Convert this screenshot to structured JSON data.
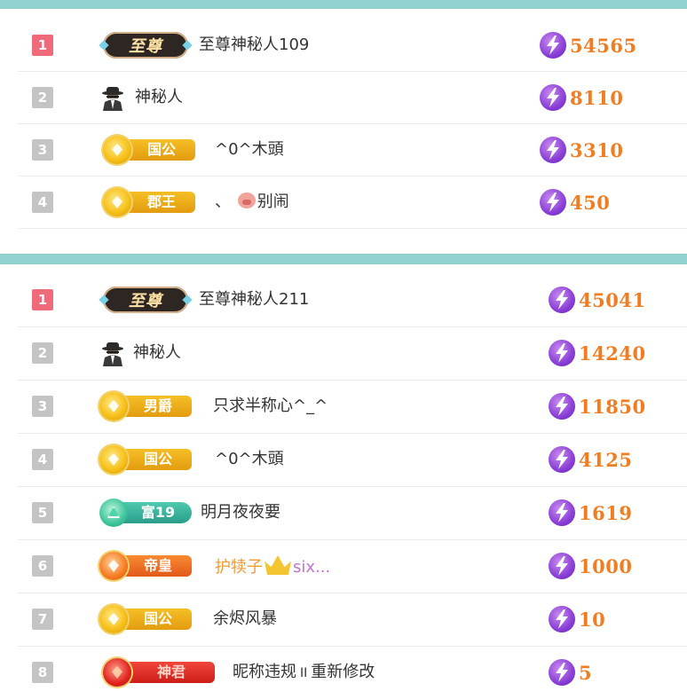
{
  "colors": {
    "accent_bar": "#91d2cf",
    "rank_first": "#f06b7a",
    "rank_other": "#c4c4c4",
    "score": "#f07d22",
    "bolt": "#8a3fd6"
  },
  "list1": {
    "rows": [
      {
        "rank": "1",
        "badge": "至尊",
        "badge_type": "zhizun",
        "name": "至尊神秘人109",
        "score": "54565"
      },
      {
        "rank": "2",
        "badge": "",
        "badge_type": "spy",
        "name": "神秘人",
        "score": "8110"
      },
      {
        "rank": "3",
        "badge": "国公",
        "badge_type": "gold",
        "name": "^0^木頭",
        "score": "3310"
      },
      {
        "rank": "4",
        "badge": "郡王",
        "badge_type": "gold",
        "name_prefix": "、",
        "name": "别闹",
        "name_icon": "pig-emoji-icon",
        "score": "450"
      }
    ]
  },
  "list2": {
    "rows": [
      {
        "rank": "1",
        "badge": "至尊",
        "badge_type": "zhizun",
        "name": "至尊神秘人211",
        "score": "45041"
      },
      {
        "rank": "2",
        "badge": "",
        "badge_type": "spy",
        "name": "神秘人",
        "score": "14240"
      },
      {
        "rank": "3",
        "badge": "男爵",
        "badge_type": "gold",
        "name": "只求半称心^_^",
        "score": "11850"
      },
      {
        "rank": "4",
        "badge": "国公",
        "badge_type": "gold",
        "name": "^0^木頭",
        "score": "4125"
      },
      {
        "rank": "5",
        "badge": "富19",
        "badge_type": "fu",
        "name": "明月夜夜要",
        "score": "1619"
      },
      {
        "rank": "6",
        "badge": "帝皇",
        "badge_type": "orange",
        "name": "护犊子",
        "name_suffix": "six...",
        "name_icon": "crown-icon",
        "score": "1000"
      },
      {
        "rank": "7",
        "badge": "国公",
        "badge_type": "gold",
        "name": "余烬风暴",
        "score": "10"
      },
      {
        "rank": "8",
        "badge": "神君",
        "badge_type": "red",
        "name_a": "昵称违规",
        "name_sep": "II",
        "name_b": "重新修改",
        "score": "5"
      }
    ]
  }
}
